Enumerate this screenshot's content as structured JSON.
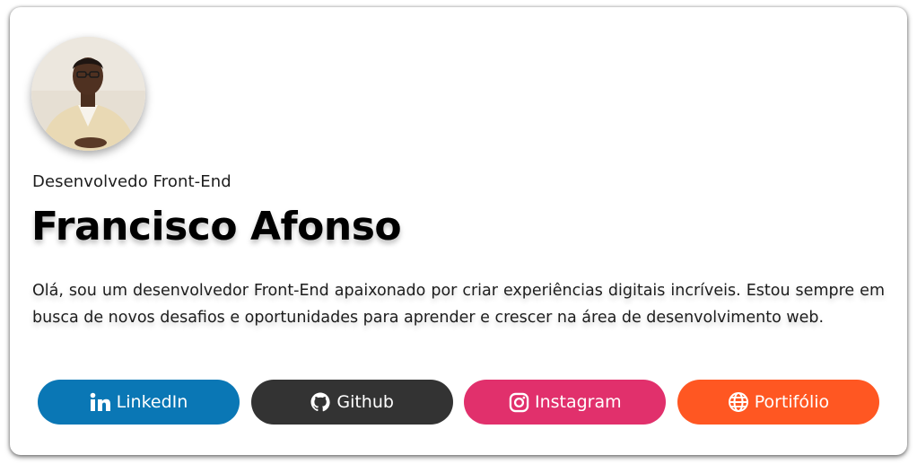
{
  "profile": {
    "role": "Desenvolvedo Front-End",
    "name": "Francisco Afonso",
    "bio": "Olá, sou um desenvolvedor Front-End apaixonado por criar experiências digitais incríveis. Estou sempre em busca de novos desafios e oportunidades para aprender e crescer na área de desenvolvimento web."
  },
  "links": {
    "linkedin": {
      "label": "LinkedIn",
      "icon": "linkedin-icon",
      "color": "#0a77b5"
    },
    "github": {
      "label": "Github",
      "icon": "github-icon",
      "color": "#333333"
    },
    "instagram": {
      "label": "Instagram",
      "icon": "instagram-icon",
      "color": "#e1306c"
    },
    "portfolio": {
      "label": "Portifólio",
      "icon": "globe-icon",
      "color": "#ff5722"
    }
  }
}
